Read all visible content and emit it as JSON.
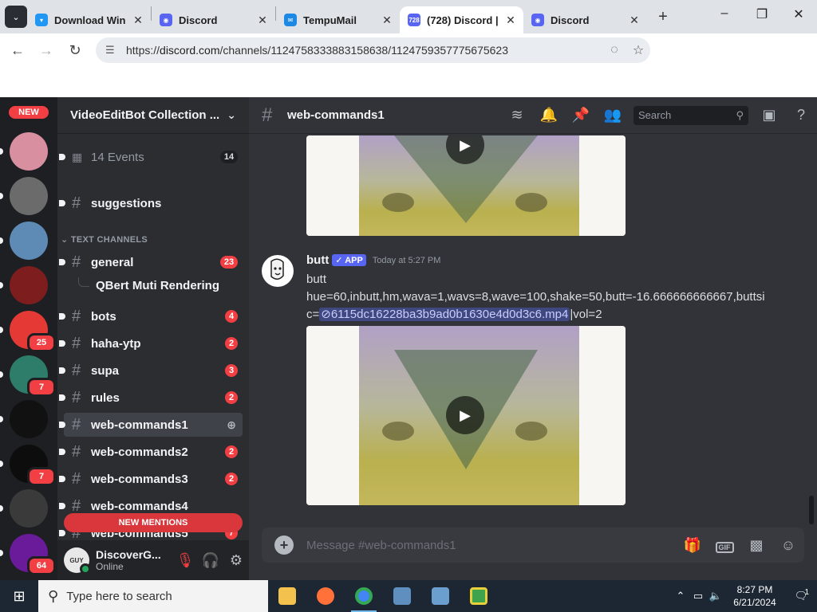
{
  "browser": {
    "tabs": [
      {
        "title": "Download Win",
        "color": "#2196f3",
        "mark": "▾"
      },
      {
        "title": "Discord",
        "color": "#5865f2",
        "mark": "◉"
      },
      {
        "title": "TempuMail",
        "color": "#1e88e5",
        "mark": "✉"
      },
      {
        "title": "(728) Discord |",
        "color": "#5865f2",
        "mark": "728",
        "active": true
      },
      {
        "title": "Discord",
        "color": "#5865f2",
        "mark": "◉"
      }
    ],
    "url_prefix": "https://",
    "url_domain": "discord.com",
    "url_path": "/channels/1124758333883158638/1124759357775675623"
  },
  "servers": {
    "new_label": "NEW",
    "items": [
      {
        "color": "#d88fa0",
        "badge": null
      },
      {
        "color": "#6b6b6b",
        "badge": null
      },
      {
        "color": "#5d8bb5",
        "badge": null
      },
      {
        "color": "#7d1d1d",
        "badge": null
      },
      {
        "color": "#e53935",
        "badge": "25"
      },
      {
        "color": "#2e7d6b",
        "badge": "7"
      },
      {
        "color": "#111111",
        "badge": null
      },
      {
        "color": "#0d0d0d",
        "badge": "7"
      },
      {
        "color": "#3a3a3a",
        "badge": null
      },
      {
        "color": "#6a1b9a",
        "badge": "64"
      }
    ]
  },
  "guild": {
    "name": "VideoEditBot Collection ...",
    "events_label": "14 Events",
    "events_count": "14",
    "suggestions": "suggestions",
    "category": "TEXT CHANNELS",
    "thread": "QBert Muti Rendering",
    "channels": [
      {
        "name": "general",
        "badge": "23"
      },
      {
        "name": "bots",
        "badge": "4"
      },
      {
        "name": "haha-ytp",
        "badge": "2"
      },
      {
        "name": "supa",
        "badge": "3"
      },
      {
        "name": "rules",
        "badge": "2"
      },
      {
        "name": "web-commands1",
        "badge": null,
        "selected": true
      },
      {
        "name": "web-commands2",
        "badge": "2"
      },
      {
        "name": "web-commands3",
        "badge": "2"
      },
      {
        "name": "web-commands4",
        "badge": null
      },
      {
        "name": "web-commands5",
        "badge": "7"
      }
    ],
    "new_mentions": "NEW MENTIONS"
  },
  "user": {
    "name": "DiscoverG...",
    "status": "Online",
    "avatar_text": "GUY"
  },
  "channel": {
    "title": "web-commands1",
    "search_placeholder": "Search"
  },
  "message": {
    "author": "butt",
    "tag": "✓ APP",
    "time": "Today at 5:27 PM",
    "line1": "butt",
    "line2": "hue=60,inbutt,hm,wava=1,wavs=8,wave=100,shake=50,butt=-16.666666666667,buttsi",
    "line3_prefix": "c=",
    "attachment": "6115dc16228ba3b9ad0b1630e4d0d3c6.mp4",
    "line3_suffix": "|vol=2"
  },
  "composer": {
    "placeholder": "Message #web-commands1",
    "gif": "GIF"
  },
  "taskbar": {
    "search_placeholder": "Type here to search",
    "time": "8:27 PM",
    "date": "6/21/2024",
    "notif": "1"
  },
  "icons": {
    "menu": "chevron-down-icon",
    "close": "close-icon",
    "search": "search-icon",
    "play": "play-icon"
  }
}
